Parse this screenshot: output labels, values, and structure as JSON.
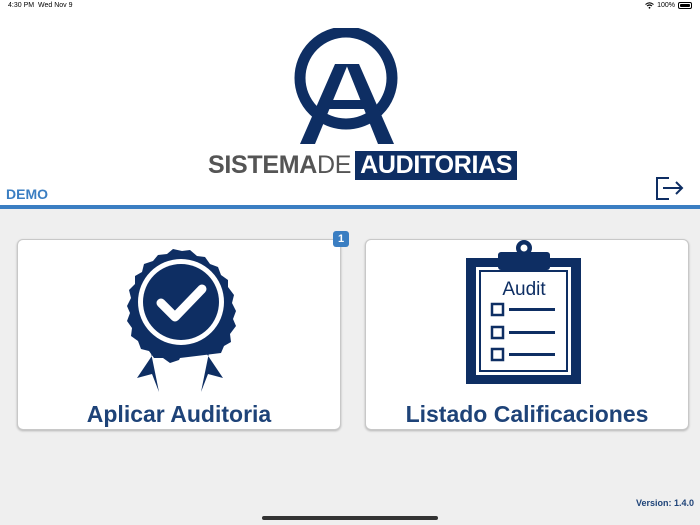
{
  "status": {
    "time": "4:30 PM",
    "date": "Wed Nov 9",
    "battery": "100%"
  },
  "brand": {
    "part1": "SISTEMA",
    "part2": "DE",
    "part3": "AUDITORIAS"
  },
  "user_label": "DEMO",
  "cards": [
    {
      "label": "Aplicar Auditoria",
      "badge": "1",
      "icon": "award-ribbon-check-icon"
    },
    {
      "label": "Listado Calificaciones",
      "icon": "audit-clipboard-icon",
      "clipboard_text": "Audit"
    }
  ],
  "version": "Version: 1.4.0",
  "colors": {
    "navy": "#0e2e63",
    "accent_blue": "#3a7ec2",
    "label_blue": "#1e4378"
  }
}
